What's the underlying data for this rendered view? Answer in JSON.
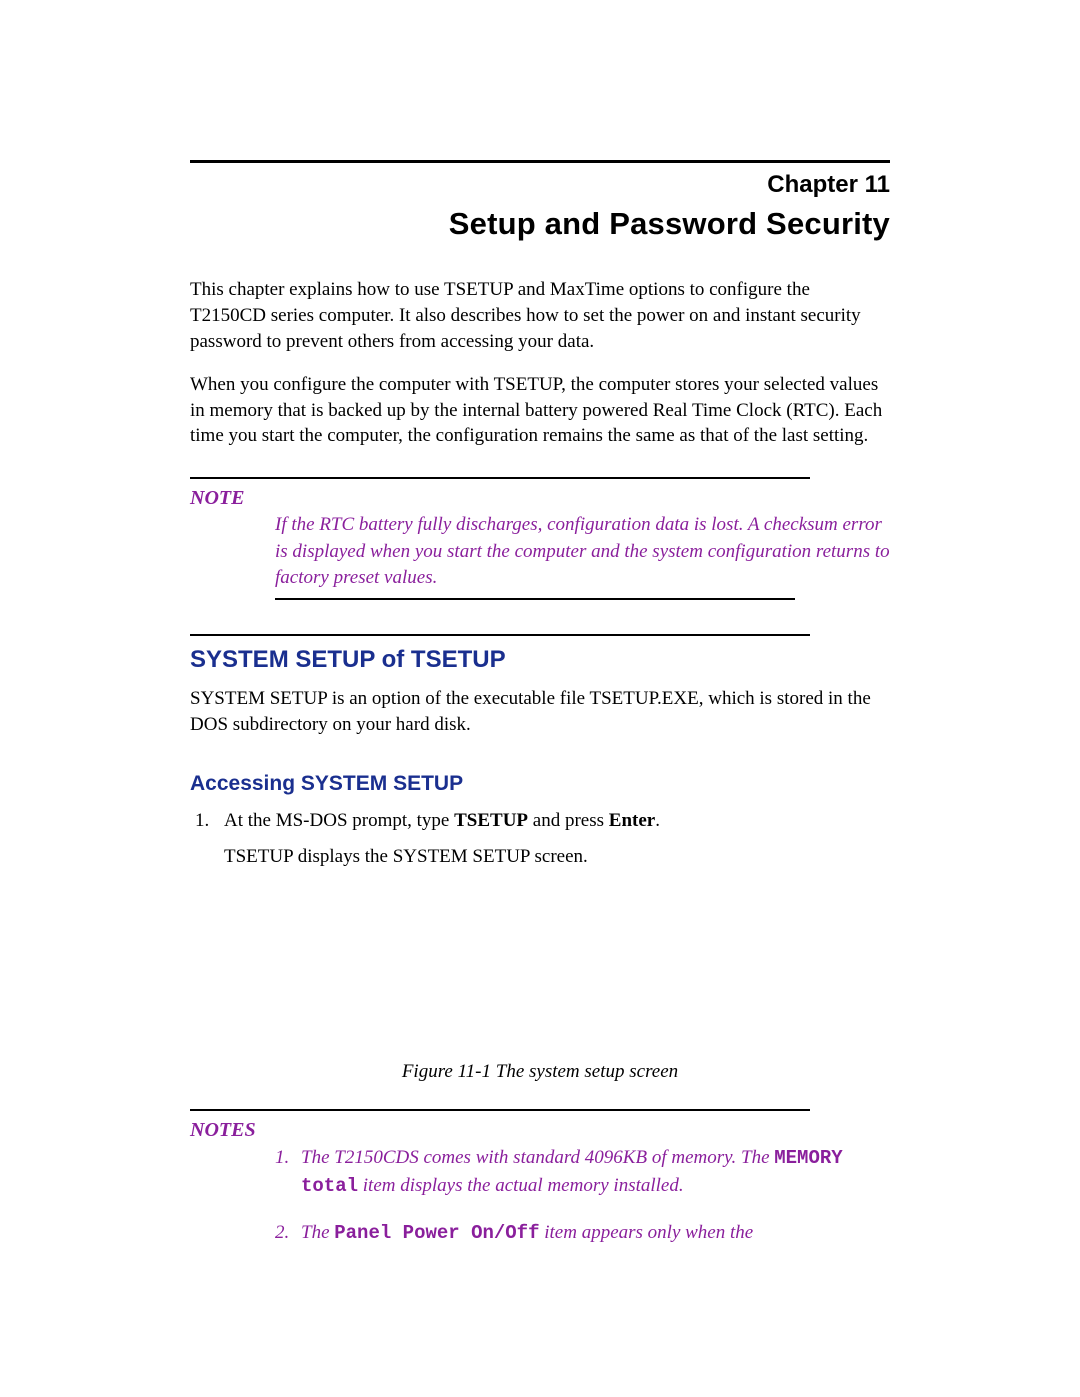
{
  "header": {
    "chapter_label": "Chapter 11",
    "chapter_title": "Setup and Password Security"
  },
  "intro": {
    "p1": "This chapter explains how to use TSETUP and MaxTime options to configure the T2150CD series computer. It also describes how to set the power on and instant security password to prevent others from accessing your data.",
    "p2": "When you configure the computer with TSETUP, the computer stores your selected values in memory that is backed up by the internal battery powered Real Time Clock (RTC).  Each time you start the computer, the configuration remains the same as that of the last setting."
  },
  "note": {
    "label": "NOTE",
    "content": "If the RTC battery fully discharges, configuration data is lost.  A checksum error is displayed when you start the computer and the system configuration returns to factory preset values."
  },
  "section1": {
    "heading": "SYSTEM SETUP of TSETUP",
    "p1": "SYSTEM SETUP is an option of the executable file TSETUP.EXE, which is stored in the DOS subdirectory on your hard disk."
  },
  "subsection1": {
    "heading": "Accessing SYSTEM SETUP",
    "step1_prefix": "At the MS-DOS prompt, type ",
    "step1_bold1": "TSETUP",
    "step1_mid": " and press ",
    "step1_bold2": "Enter",
    "step1_suffix": ".",
    "step1_sub": "TSETUP displays the SYSTEM SETUP screen."
  },
  "figure": {
    "caption": "Figure 11-1 The system setup screen"
  },
  "notes": {
    "label": "NOTES",
    "item1_num": "1.",
    "item1_a": "The T2150CDS comes with standard 4096KB of memory. The ",
    "item1_mono": "MEMORY total",
    "item1_b": " item displays the actual memory installed.",
    "item2_num": "2.",
    "item2_a": "The ",
    "item2_mono": "Panel Power On/Off",
    "item2_b": " item appears only when the"
  }
}
